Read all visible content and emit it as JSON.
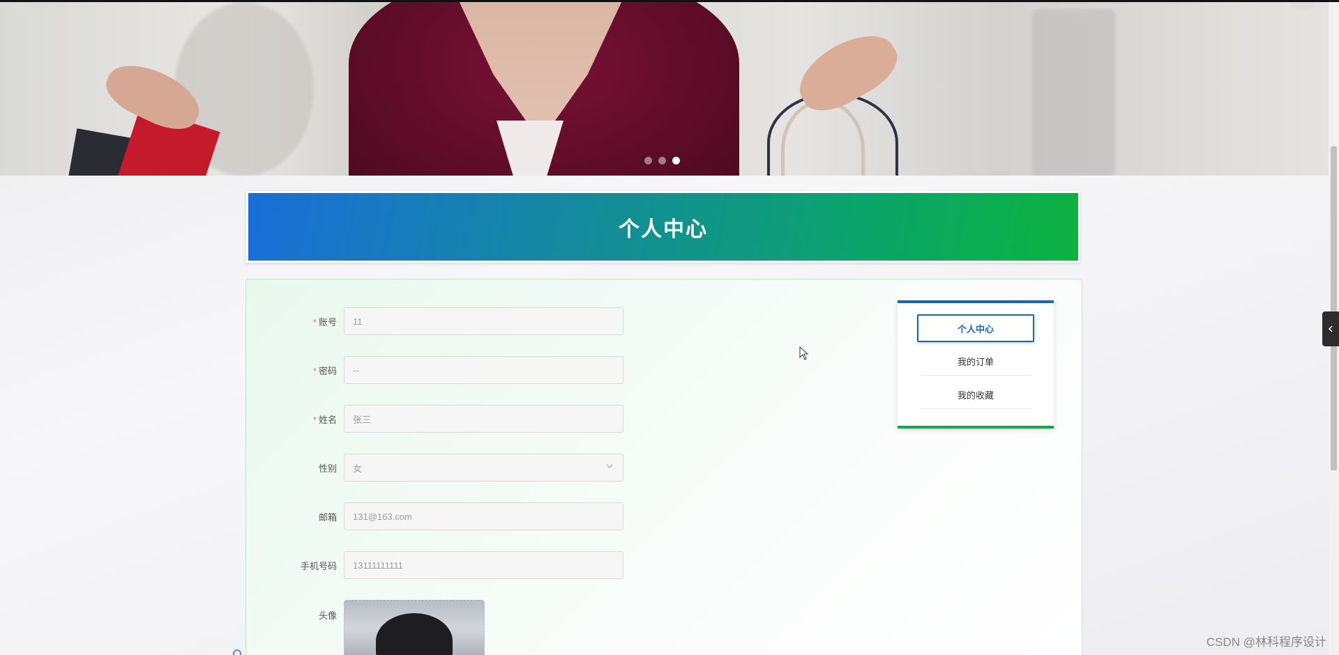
{
  "banner": {
    "slide_count": 3,
    "active_slide": 3
  },
  "header": {
    "title": "个人中心"
  },
  "form": {
    "account": {
      "label": "账号",
      "required": true,
      "value": "11"
    },
    "password": {
      "label": "密码",
      "required": true,
      "value": "--"
    },
    "name": {
      "label": "姓名",
      "required": true,
      "value": "张三"
    },
    "gender": {
      "label": "性别",
      "required": false,
      "value": "女"
    },
    "email": {
      "label": "邮箱",
      "required": false,
      "value": "131@163.com"
    },
    "phone": {
      "label": "手机号码",
      "required": false,
      "value": "13111111111"
    },
    "avatar": {
      "label": "头像",
      "required": false
    }
  },
  "side_menu": {
    "items": [
      {
        "label": "个人中心",
        "active": true
      },
      {
        "label": "我的订单",
        "active": false
      },
      {
        "label": "我的收藏",
        "active": false
      }
    ]
  },
  "icons": {
    "required_marker": "*",
    "select_chevron": "chevron-down-icon",
    "collapse_tab": "chevron-left-icon"
  },
  "colors": {
    "primary_blue": "#1565c0",
    "accent_green": "#13a94a",
    "required_red": "#f56c6c"
  },
  "watermark": "CSDN @林科程序设计"
}
